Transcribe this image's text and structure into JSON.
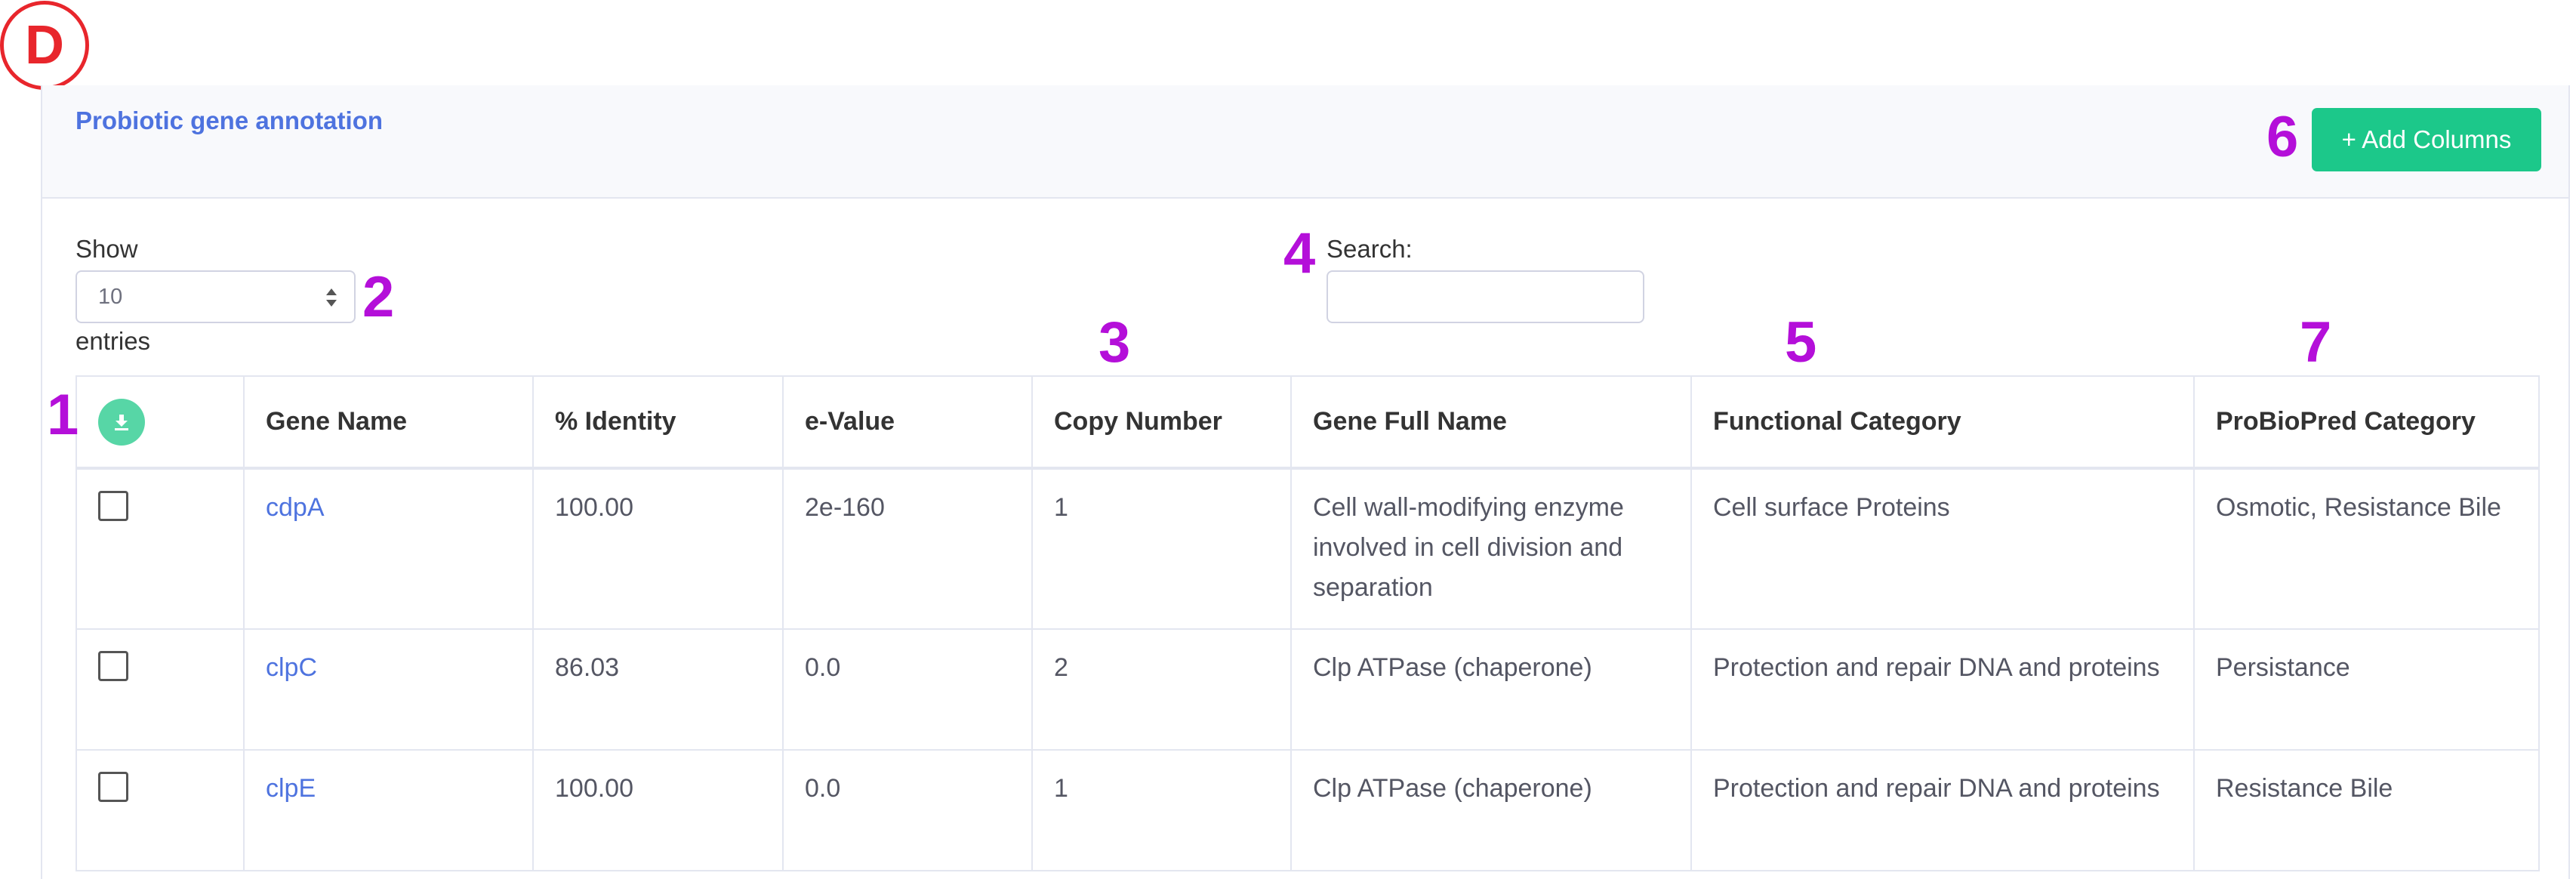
{
  "panel_label": "D",
  "card": {
    "title": "Probiotic gene annotation",
    "add_columns_label": "+ Add Columns"
  },
  "length_control": {
    "show_label": "Show",
    "selected_value": "10",
    "entries_label": "entries"
  },
  "search": {
    "label": "Search:",
    "value": ""
  },
  "annotations": {
    "a1": "1",
    "a2": "2",
    "a3": "3",
    "a4": "4",
    "a5": "5",
    "a6": "6",
    "a7": "7"
  },
  "table": {
    "select_icon": "download-icon",
    "headers": {
      "gene_name": "Gene Name",
      "identity": "% Identity",
      "evalue": "e-Value",
      "copy_number": "Copy Number",
      "full_name": "Gene Full Name",
      "functional_category": "Functional Category",
      "probiopred_category": "ProBioPred Category"
    },
    "rows": [
      {
        "gene_name": "cdpA",
        "identity": "100.00",
        "evalue": "2e-160",
        "copy_number": "1",
        "full_name": "Cell wall-modifying enzyme involved in cell division and separation",
        "functional_category": "Cell surface Proteins",
        "probiopred_category": "Osmotic, Resistance Bile"
      },
      {
        "gene_name": "clpC",
        "identity": "86.03",
        "evalue": "0.0",
        "copy_number": "2",
        "full_name": "Clp ATPase (chaperone)",
        "functional_category": "Protection and repair DNA and proteins",
        "probiopred_category": "Persistance"
      },
      {
        "gene_name": "clpE",
        "identity": "100.00",
        "evalue": "0.0",
        "copy_number": "1",
        "full_name": "Clp ATPase (chaperone)",
        "functional_category": "Protection and repair DNA and proteins",
        "probiopred_category": "Resistance Bile"
      }
    ]
  },
  "colors": {
    "accent": "#4e73df",
    "success": "#1cc88a",
    "annotation": "#b40fd9",
    "panel_label": "#e8262c"
  }
}
